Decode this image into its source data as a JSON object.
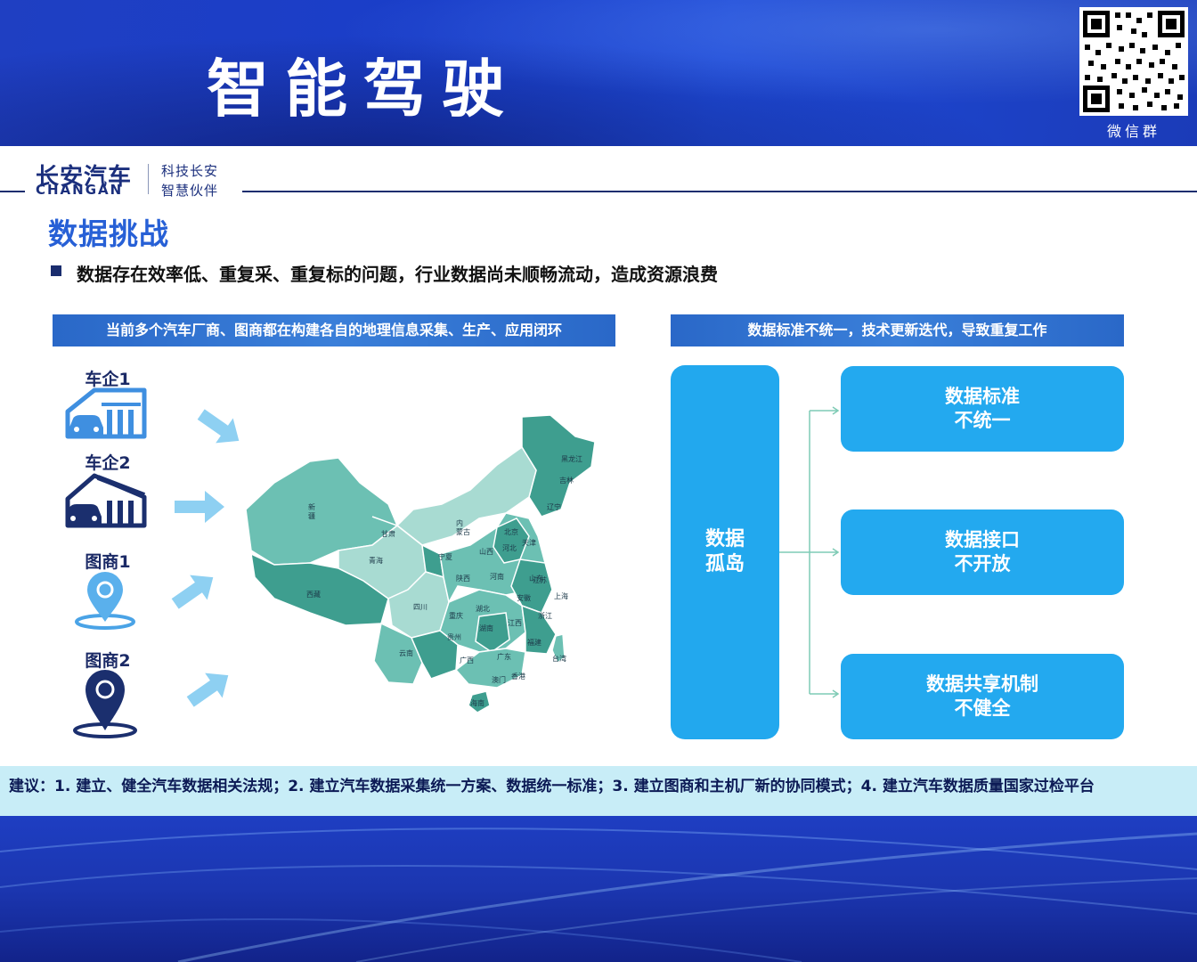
{
  "header": {
    "title": "智能驾驶",
    "qr_label": "微信群"
  },
  "brand": {
    "name_cn": "长安汽车",
    "name_en": "CHANGAN",
    "slogan_line1": "科技长安",
    "slogan_line2": "智慧伙伴"
  },
  "section": {
    "title": "数据挑战",
    "bullet": "数据存在效率低、重复采、重复标的问题，行业数据尚未顺畅流动，造成资源浪费"
  },
  "left_panel": {
    "banner": "当前多个汽车厂商、图商都在构建各自的地理信息采集、生产、应用闭环",
    "entities": [
      {
        "label": "车企1",
        "icon": "car-garage-icon"
      },
      {
        "label": "车企2",
        "icon": "car-garage-icon"
      },
      {
        "label": "图商1",
        "icon": "map-pin-icon"
      },
      {
        "label": "图商2",
        "icon": "map-pin-icon"
      }
    ],
    "map_labels": [
      "新疆",
      "西藏",
      "青海",
      "甘肃",
      "内蒙古",
      "宁夏",
      "陕西",
      "山西",
      "河北",
      "北京",
      "天津",
      "辽宁",
      "吉林",
      "黑龙江",
      "山东",
      "河南",
      "湖北",
      "重庆",
      "四川",
      "贵州",
      "云南",
      "湖南",
      "江西",
      "安徽",
      "江苏",
      "上海",
      "浙江",
      "福建",
      "广东",
      "广西",
      "海南",
      "香港",
      "澳门",
      "台湾"
    ],
    "colors": {
      "map_dark": "#3e9e8f",
      "map_light": "#a8dbd2",
      "map_mid": "#6cc0b3"
    }
  },
  "right_panel": {
    "banner": "数据标准不统一，技术更新迭代，导致重复工作",
    "island_line1": "数据",
    "island_line2": "孤岛",
    "boxes": [
      {
        "line1": "数据标准",
        "line2": "不统一"
      },
      {
        "line1": "数据接口",
        "line2": "不开放"
      },
      {
        "line1": "数据共享机制",
        "line2": "不健全"
      }
    ],
    "colors": {
      "box": "#23a9ef"
    }
  },
  "suggestion": "建议：1. 建立、健全汽车数据相关法规；2. 建立汽车数据采集统一方案、数据统一标准；3. 建立图商和主机厂新的协同模式；4. 建立汽车数据质量国家过检平台"
}
